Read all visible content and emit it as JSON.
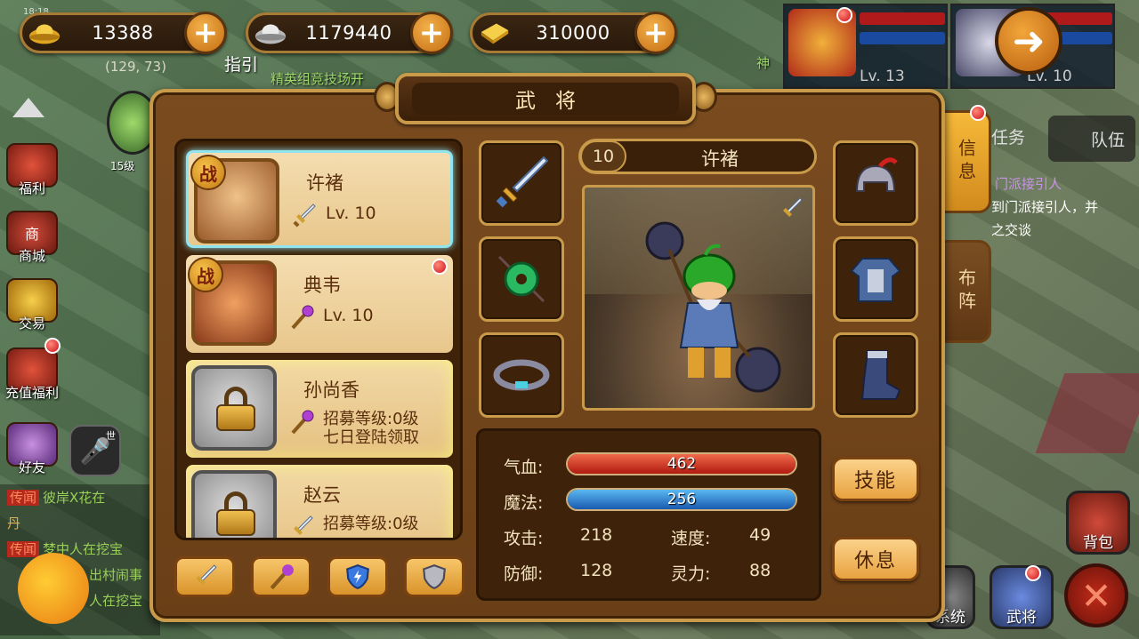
{
  "currencies": [
    {
      "id": "gold-ingot",
      "value": "13388"
    },
    {
      "id": "silver-ingot",
      "value": "1179440"
    },
    {
      "id": "gold-bar",
      "value": "310000"
    }
  ],
  "map": {
    "coords": "(129, 73)",
    "time": "18:18"
  },
  "world_text": {
    "guide": "指引",
    "event": "精英组竞技场开",
    "shenbing": "神",
    "level_label": "15级"
  },
  "side_menu": [
    {
      "label": "福利"
    },
    {
      "label": "商城",
      "sign": "商"
    },
    {
      "label": "交易"
    },
    {
      "label": "充值福利"
    },
    {
      "label": "好友"
    }
  ],
  "mic": {
    "tag": "世"
  },
  "chat": [
    {
      "tag": "传闻",
      "text": "彼岸X花在"
    },
    {
      "tag": "",
      "text": "丹"
    },
    {
      "tag": "传闻",
      "text": "梦中人在挖宝"
    },
    {
      "tag": "",
      "text": "出村闹事"
    },
    {
      "tag": "",
      "text": "人在挖宝"
    }
  ],
  "party": [
    {
      "level": "Lv. 13"
    },
    {
      "level": "Lv. 10"
    }
  ],
  "right_tabs": {
    "info": "信息",
    "formation": "布阵"
  },
  "right_text": {
    "team": "队伍",
    "task": "任务",
    "npc1": "门派接引人",
    "npc2": "到门派接引人，并",
    "talk": "之交谈"
  },
  "bottom_right": {
    "bag": "背包",
    "hero": "武将",
    "system": "系统"
  },
  "panel": {
    "title": "武将"
  },
  "heroes": [
    {
      "name": "许褚",
      "level_text": "Lv. 10",
      "badge": "战",
      "weapon": "sword"
    },
    {
      "name": "典韦",
      "level_text": "Lv. 10",
      "badge": "战",
      "weapon": "staff"
    },
    {
      "name": "孙尚香",
      "level_text": "招募等级:0级",
      "extra": "七日登陆领取",
      "weapon": "staff"
    },
    {
      "name": "赵云",
      "level_text": "招募等级:0级",
      "weapon": "sword"
    }
  ],
  "selected_hero": {
    "level": "10",
    "name": "许褚",
    "stats": {
      "hp_label": "气血:",
      "hp": "462",
      "hp_pct": 100,
      "mp_label": "魔法:",
      "mp": "256",
      "mp_pct": 100,
      "atk_label": "攻击:",
      "atk": "218",
      "spd_label": "速度:",
      "spd": "49",
      "def_label": "防御:",
      "def": "128",
      "spi_label": "灵力:",
      "spi": "88"
    }
  },
  "actions": {
    "skill": "技能",
    "rest": "休息"
  },
  "colors": {
    "panel": "#7a4b1f",
    "border": "#c99a4a",
    "hp": "#d83a2a",
    "mp": "#2a8ee0",
    "accent": "#f2b04a"
  }
}
